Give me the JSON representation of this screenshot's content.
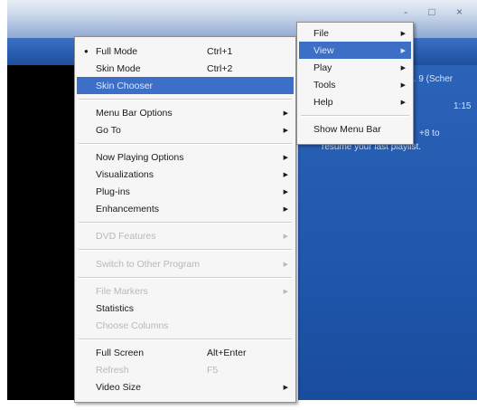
{
  "window": {
    "controls": "- □ ×"
  },
  "now_playing": {
    "title": "lo. 9 (Scher",
    "time": "1:15",
    "hint_line1": "+8 to",
    "hint_line2": "resume your last playlist."
  },
  "main_menu": {
    "items": [
      {
        "label": "Full Mode",
        "shortcut": "Ctrl+1",
        "checked": true
      },
      {
        "label": "Skin Mode",
        "shortcut": "Ctrl+2"
      },
      {
        "label": "Skin Chooser",
        "highlighted": true
      },
      {
        "label": "Menu Bar Options",
        "submenu": true
      },
      {
        "label": "Go To",
        "submenu": true
      },
      {
        "label": "Now Playing Options",
        "submenu": true
      },
      {
        "label": "Visualizations",
        "submenu": true
      },
      {
        "label": "Plug-ins",
        "submenu": true
      },
      {
        "label": "Enhancements",
        "submenu": true
      },
      {
        "label": "DVD Features",
        "submenu": true,
        "disabled": true
      },
      {
        "label": "Switch to Other Program",
        "submenu": true,
        "disabled": true
      },
      {
        "label": "File Markers",
        "submenu": true,
        "disabled": true
      },
      {
        "label": "Statistics"
      },
      {
        "label": "Choose Columns",
        "disabled": true
      },
      {
        "label": "Full Screen",
        "shortcut": "Alt+Enter"
      },
      {
        "label": "Refresh",
        "shortcut": "F5",
        "disabled": true
      },
      {
        "label": "Video Size",
        "submenu": true
      }
    ]
  },
  "sub_menu": {
    "items": [
      {
        "label": "File"
      },
      {
        "label": "View",
        "highlighted": true
      },
      {
        "label": "Play"
      },
      {
        "label": "Tools"
      },
      {
        "label": "Help"
      },
      {
        "label": "Show Menu Bar"
      }
    ]
  },
  "colors": {
    "highlight": "#3d6fc7",
    "player_blue": "#2c63b9"
  }
}
